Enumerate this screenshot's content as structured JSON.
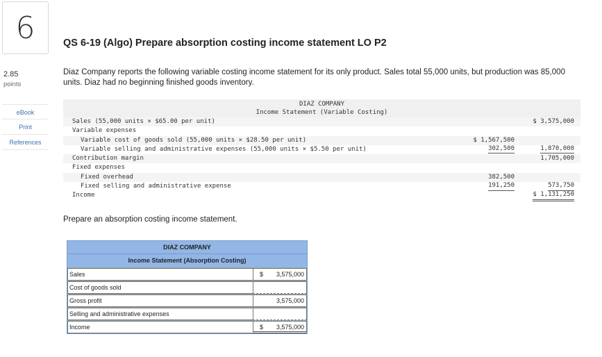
{
  "question": {
    "number": "6",
    "title": "QS 6-19 (Algo) Prepare absorption costing income statement LO P2",
    "points_value": "2.85",
    "points_label": "points",
    "prompt": "Diaz Company reports the following variable costing income statement for its only product. Sales total 55,000 units, but production was 85,000 units. Diaz had no beginning finished goods inventory.",
    "instruction": "Prepare an absorption costing income statement."
  },
  "side_links": [
    "eBook",
    "Print",
    "References"
  ],
  "given_statement": {
    "company": "DIAZ COMPANY",
    "subtitle": "Income Statement (Variable Costing)",
    "rows": [
      {
        "label": "Sales (55,000 units × $65.00 per unit)",
        "indent": false,
        "mid": "",
        "right": "$ 3,575,000"
      },
      {
        "label": "Variable expenses",
        "indent": false,
        "mid": "",
        "right": ""
      },
      {
        "label": "Variable cost of goods sold (55,000 units × $28.50 per unit)",
        "indent": true,
        "mid": "$ 1,567,500",
        "right": ""
      },
      {
        "label": "Variable selling and administrative expenses (55,000 units × $5.50 per unit)",
        "indent": true,
        "mid": "302,500",
        "right": "1,870,000"
      },
      {
        "label": "Contribution margin",
        "indent": false,
        "mid": "",
        "right": "1,705,000"
      },
      {
        "label": "Fixed expenses",
        "indent": false,
        "mid": "",
        "right": ""
      },
      {
        "label": "Fixed overhead",
        "indent": true,
        "mid": "382,500",
        "right": ""
      },
      {
        "label": "Fixed selling and administrative expense",
        "indent": true,
        "mid": "191,250",
        "right": "573,750"
      },
      {
        "label": "Income",
        "indent": false,
        "mid": "",
        "right": "$ 1,131,250"
      }
    ]
  },
  "answer_table": {
    "company": "DIAZ COMPANY",
    "subtitle": "Income Statement (Absorption Costing)",
    "rows": [
      {
        "label": "Sales",
        "dollar": "$",
        "value": "3,575,000"
      },
      {
        "label": "Cost of goods sold",
        "dollar": "",
        "value": ""
      },
      {
        "label": "Gross profit",
        "dollar": "",
        "value": "3,575,000"
      },
      {
        "label": "Selling and administrative expenses",
        "dollar": "",
        "value": ""
      },
      {
        "label": "Income",
        "dollar": "$",
        "value": "3,575,000"
      }
    ]
  }
}
